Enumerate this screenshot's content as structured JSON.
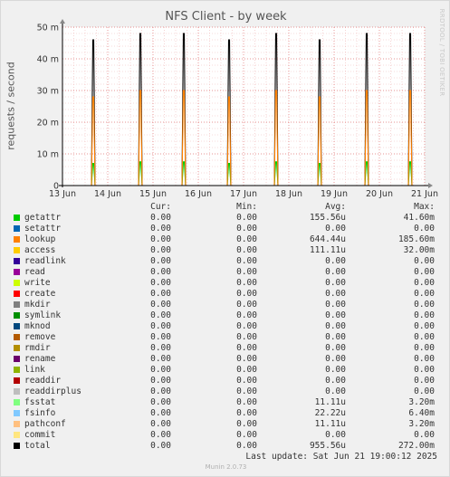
{
  "chart_data": {
    "type": "line",
    "title": "NFS Client - by week",
    "xlabel": "",
    "ylabel": "requests / second",
    "x": [
      "13 Jun",
      "14 Jun",
      "15 Jun",
      "16 Jun",
      "17 Jun",
      "18 Jun",
      "19 Jun",
      "20 Jun",
      "21 Jun"
    ],
    "yticks": [
      "0",
      "10 m",
      "20 m",
      "30 m",
      "40 m",
      "50 m"
    ],
    "ylim": [
      0,
      50
    ],
    "y_unit": "m (milli-requests per second)",
    "grid": true,
    "series": [
      {
        "name": "total",
        "peaks_at_day_offset": [
          0.68,
          1.72,
          2.68,
          3.68,
          4.72,
          5.68,
          6.72,
          7.68
        ],
        "peak_values": [
          46,
          48,
          48,
          46,
          48,
          46,
          48,
          48
        ]
      },
      {
        "name": "getattr",
        "peaks_at_day_offset": [
          0.68,
          1.72,
          2.68,
          3.68,
          4.72,
          5.68,
          6.72,
          7.68
        ],
        "peak_values": [
          7,
          7.5,
          7.5,
          7,
          7.5,
          7,
          7.5,
          7.5
        ]
      },
      {
        "name": "lookup",
        "peaks_at_day_offset": [
          0.68,
          1.72,
          2.68,
          3.68,
          4.72,
          5.68,
          6.72,
          7.68
        ],
        "peak_values": [
          28,
          30,
          30,
          28,
          30,
          28,
          30,
          30
        ]
      }
    ]
  },
  "watermark": "RRDTOOL / TOBI OETIKER",
  "legend": {
    "headers": {
      "cur": "Cur:",
      "min": "Min:",
      "avg": "Avg:",
      "max": "Max:"
    },
    "rows": [
      {
        "name": "getattr",
        "color": "#00cc00",
        "cur": "0.00",
        "min": "0.00",
        "avg": "155.56u",
        "max": "41.60m"
      },
      {
        "name": "setattr",
        "color": "#0066b3",
        "cur": "0.00",
        "min": "0.00",
        "avg": "0.00",
        "max": "0.00"
      },
      {
        "name": "lookup",
        "color": "#ff8000",
        "cur": "0.00",
        "min": "0.00",
        "avg": "644.44u",
        "max": "185.60m"
      },
      {
        "name": "access",
        "color": "#ffcc00",
        "cur": "0.00",
        "min": "0.00",
        "avg": "111.11u",
        "max": "32.00m"
      },
      {
        "name": "readlink",
        "color": "#330099",
        "cur": "0.00",
        "min": "0.00",
        "avg": "0.00",
        "max": "0.00"
      },
      {
        "name": "read",
        "color": "#990099",
        "cur": "0.00",
        "min": "0.00",
        "avg": "0.00",
        "max": "0.00"
      },
      {
        "name": "write",
        "color": "#ccff00",
        "cur": "0.00",
        "min": "0.00",
        "avg": "0.00",
        "max": "0.00"
      },
      {
        "name": "create",
        "color": "#ff0000",
        "cur": "0.00",
        "min": "0.00",
        "avg": "0.00",
        "max": "0.00"
      },
      {
        "name": "mkdir",
        "color": "#808080",
        "cur": "0.00",
        "min": "0.00",
        "avg": "0.00",
        "max": "0.00"
      },
      {
        "name": "symlink",
        "color": "#008f00",
        "cur": "0.00",
        "min": "0.00",
        "avg": "0.00",
        "max": "0.00"
      },
      {
        "name": "mknod",
        "color": "#00487d",
        "cur": "0.00",
        "min": "0.00",
        "avg": "0.00",
        "max": "0.00"
      },
      {
        "name": "remove",
        "color": "#b35a00",
        "cur": "0.00",
        "min": "0.00",
        "avg": "0.00",
        "max": "0.00"
      },
      {
        "name": "rmdir",
        "color": "#b38f00",
        "cur": "0.00",
        "min": "0.00",
        "avg": "0.00",
        "max": "0.00"
      },
      {
        "name": "rename",
        "color": "#6b006b",
        "cur": "0.00",
        "min": "0.00",
        "avg": "0.00",
        "max": "0.00"
      },
      {
        "name": "link",
        "color": "#8fb300",
        "cur": "0.00",
        "min": "0.00",
        "avg": "0.00",
        "max": "0.00"
      },
      {
        "name": "readdir",
        "color": "#b30000",
        "cur": "0.00",
        "min": "0.00",
        "avg": "0.00",
        "max": "0.00"
      },
      {
        "name": "readdirplus",
        "color": "#bebebe",
        "cur": "0.00",
        "min": "0.00",
        "avg": "0.00",
        "max": "0.00"
      },
      {
        "name": "fsstat",
        "color": "#80ff80",
        "cur": "0.00",
        "min": "0.00",
        "avg": "11.11u",
        "max": "3.20m"
      },
      {
        "name": "fsinfo",
        "color": "#80c9ff",
        "cur": "0.00",
        "min": "0.00",
        "avg": "22.22u",
        "max": "6.40m"
      },
      {
        "name": "pathconf",
        "color": "#ffc080",
        "cur": "0.00",
        "min": "0.00",
        "avg": "11.11u",
        "max": "3.20m"
      },
      {
        "name": "commit",
        "color": "#ffe680",
        "cur": "0.00",
        "min": "0.00",
        "avg": "0.00",
        "max": "0.00"
      },
      {
        "name": "total",
        "color": "#000000",
        "cur": "0.00",
        "min": "0.00",
        "avg": "955.56u",
        "max": "272.00m"
      }
    ]
  },
  "last_update": "Last update: Sat Jun 21 19:00:12 2025",
  "version": "Munin 2.0.73"
}
